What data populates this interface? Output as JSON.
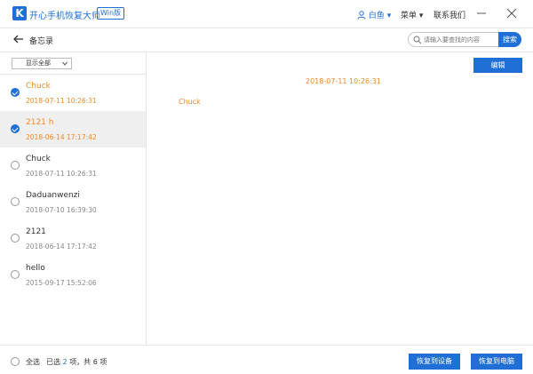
{
  "app": {
    "logo_letter": "K",
    "title": "开心手机恢复大师",
    "badge": "Win版",
    "user_name": "白鱼",
    "menu_label": "菜单",
    "contact_label": "联系我们"
  },
  "header": {
    "page_title": "备忘录",
    "search_placeholder": "请输入要查找的内容",
    "search_button": "搜索"
  },
  "sidebar": {
    "filter_label": "显示全部",
    "items": [
      {
        "title": "Chuck",
        "date": "2018-07-11 10:26:31",
        "checked": true,
        "selected": false
      },
      {
        "title": "2121 h",
        "date": "2018-06-14 17:17:42",
        "checked": true,
        "selected": true
      },
      {
        "title": "Chuck",
        "date": "2018-07-11 10:26:31",
        "checked": false,
        "selected": false
      },
      {
        "title": "Daduanwenzi",
        "date": "2018-07-10 16:39:30",
        "checked": false,
        "selected": false
      },
      {
        "title": "2121",
        "date": "2018-06-14 17:17:42",
        "checked": false,
        "selected": false
      },
      {
        "title": "hello",
        "date": "2015-09-17 15:52:06",
        "checked": false,
        "selected": false
      }
    ]
  },
  "content": {
    "edit_button": "编辑",
    "note_date": "2018-07-11 10:26:31",
    "note_body": "Chuck"
  },
  "footer": {
    "select_all": "全选",
    "selected_prefix": "已选",
    "selected_count": "2",
    "selected_mid": "项，共",
    "total_count": "6",
    "selected_suffix": "项",
    "restore_device": "恢复到设备",
    "restore_pc": "恢复到电脑"
  },
  "colors": {
    "accent": "#1f6fd6",
    "highlight": "#f08a24"
  }
}
